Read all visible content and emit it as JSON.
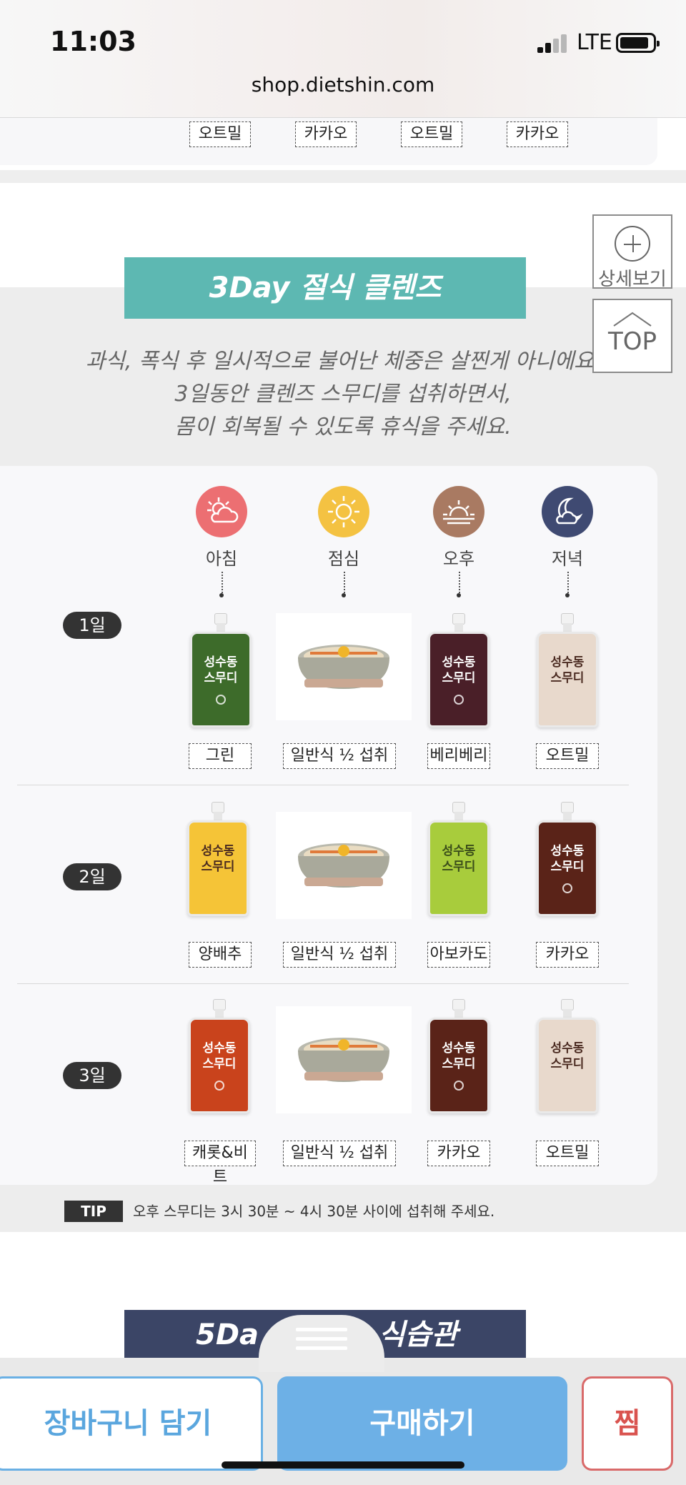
{
  "status": {
    "time": "11:03",
    "network": "LTE"
  },
  "browser": {
    "url": "shop.dietshin.com"
  },
  "top_flavors": [
    "오트밀",
    "카카오",
    "오트밀",
    "카카오"
  ],
  "section": {
    "title": "3Day 절식 클렌즈",
    "desc": [
      "과식, 폭식 후 일시적으로 불어난 체중은 살찐게 아니에요.",
      "3일동안 클렌즈 스무디를 섭취하면서,",
      "몸이 회복될 수 있도록 휴식을 주세요."
    ]
  },
  "side_buttons": {
    "detail": "상세보기",
    "top": "TOP"
  },
  "meal_times": [
    {
      "label": "아침",
      "icon": "morning-cloud-sun-icon",
      "color": "#ec6f72"
    },
    {
      "label": "점심",
      "icon": "sun-icon",
      "color": "#f4c242"
    },
    {
      "label": "오후",
      "icon": "sunset-icon",
      "color": "#a97a62"
    },
    {
      "label": "저녁",
      "icon": "moon-cloud-icon",
      "color": "#3f4a72"
    }
  ],
  "days": [
    {
      "label": "1일",
      "items": [
        "그린",
        "일반식 ½ 섭취",
        "베리베리",
        "오트밀"
      ]
    },
    {
      "label": "2일",
      "items": [
        "양배추",
        "일반식 ½ 섭취",
        "아보카도",
        "카카오"
      ]
    },
    {
      "label": "3일",
      "items": [
        "캐롯&비트",
        "일반식 ½ 섭취",
        "카카오",
        "오트밀"
      ]
    }
  ],
  "product_brand": [
    "성수동",
    "스무디"
  ],
  "tip": {
    "badge": "TIP",
    "text": "오후 스무디는 3시 30분 ~ 4시 30분 사이에 섭취해 주세요."
  },
  "next_section": {
    "left": "5Da",
    "right": "식습관"
  },
  "bottom_bar": {
    "cart": "장바구니 담기",
    "buy": "구매하기",
    "wish": "찜"
  }
}
